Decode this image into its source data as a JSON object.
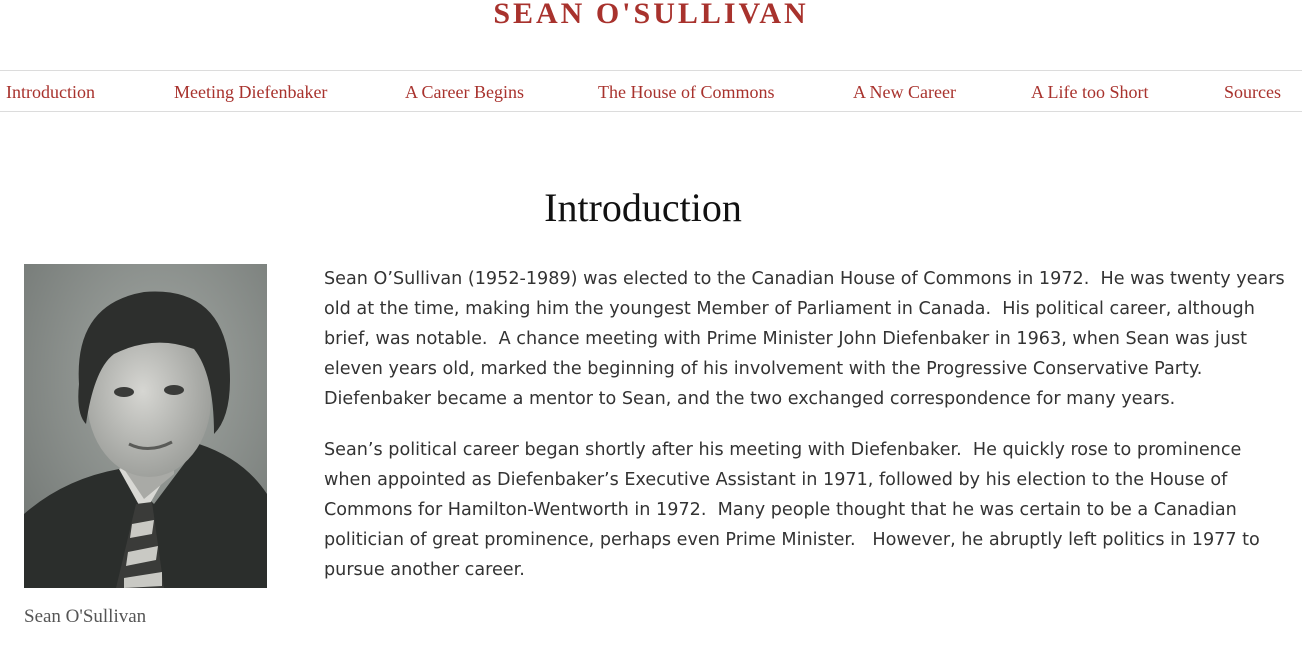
{
  "site": {
    "title": "SEAN O'SULLIVAN",
    "accent_color": "#a8322d"
  },
  "nav": {
    "items": [
      {
        "label": "Introduction"
      },
      {
        "label": "Meeting Diefenbaker"
      },
      {
        "label": "A Career Begins"
      },
      {
        "label": "The House of Commons"
      },
      {
        "label": "A New Career"
      },
      {
        "label": "A Life too Short"
      },
      {
        "label": "Sources"
      }
    ]
  },
  "main": {
    "heading": "Introduction",
    "image": {
      "caption": "Sean O'Sullivan",
      "alt": "portrait-photo"
    },
    "paragraphs": [
      "Sean O’Sullivan (1952-1989) was elected to the Canadian House of Commons in 1972.  He was twenty years old at the time, making him the youngest Member of Parliament in Canada.  His political career, although brief, was notable.  A chance meeting with Prime Minister John Diefenbaker in 1963, when Sean was just eleven years old, marked the beginning of his involvement with the Progressive Conservative Party.  Diefenbaker became a mentor to Sean, and the two exchanged correspondence for many years.",
      "Sean’s political career began shortly after his meeting with Diefenbaker.  He quickly rose to prominence when appointed as Diefenbaker’s Executive Assistant in 1971, followed by his election to the House of Commons for Hamilton-Wentworth in 1972.  Many people thought that he was certain to be a Canadian politician of great prominence, perhaps even Prime Minister.   However, he abruptly left politics in 1977 to pursue another career."
    ]
  }
}
